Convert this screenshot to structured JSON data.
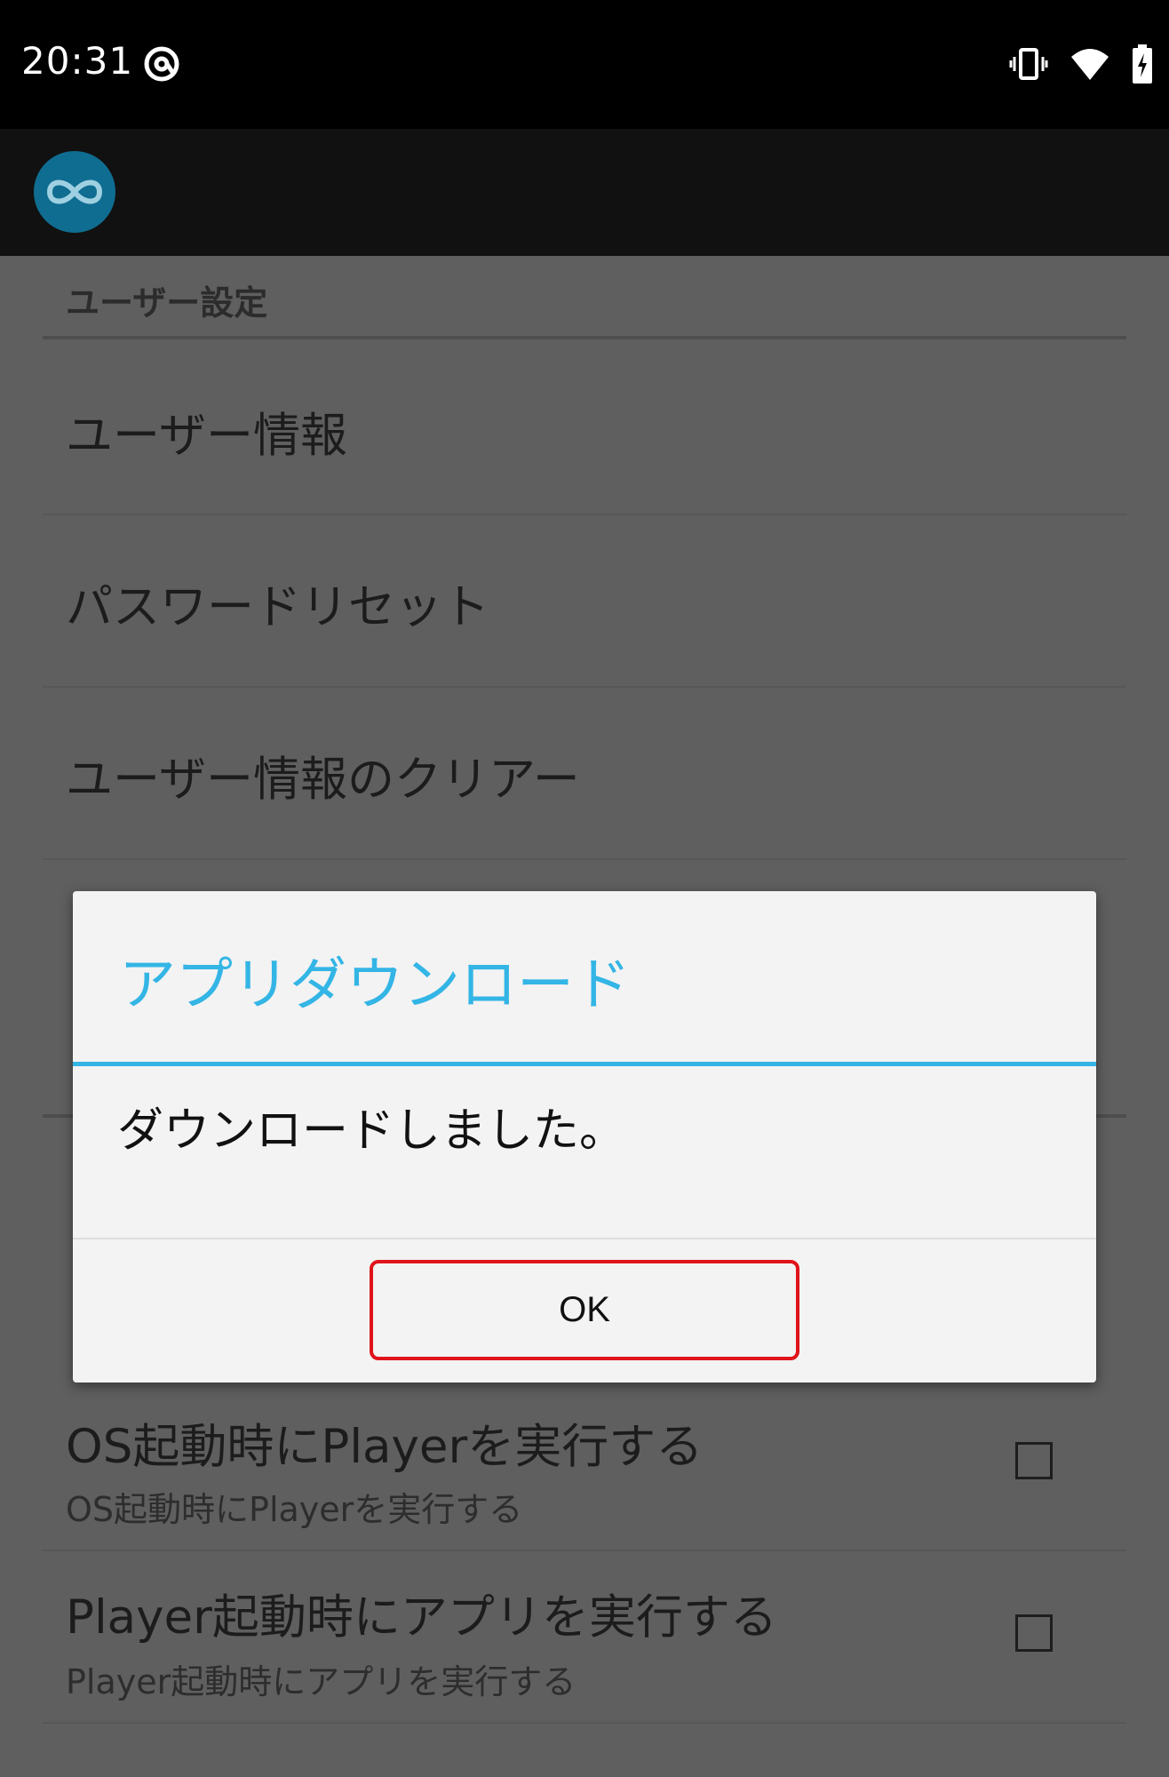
{
  "status_bar": {
    "time": "20:31",
    "icons": [
      "at-sign-icon",
      "vibrate-icon",
      "wifi-icon",
      "battery-charging-icon"
    ]
  },
  "app_bar": {
    "logo": "infinity-link-logo"
  },
  "settings": {
    "section_user": "ユーザー設定",
    "user_info": "ユーザー情報",
    "password_reset": "パスワードリセット",
    "clear_user_info": "ユーザー情報のクリアー",
    "run_on_os_boot": {
      "title": "OS起動時にPlayerを実行する",
      "summary": "OS起動時にPlayerを実行する",
      "checked": false
    },
    "run_app_on_player_start": {
      "title": "Player起動時にアプリを実行する",
      "summary": "Player起動時にアプリを実行する",
      "checked": false
    }
  },
  "dialog": {
    "title": "アプリダウンロード",
    "message": "ダウンロードしました。",
    "ok_label": "OK"
  },
  "colors": {
    "accent": "#33b5e5",
    "highlight": "#e0131b",
    "overlay": "#5f5f5f"
  }
}
